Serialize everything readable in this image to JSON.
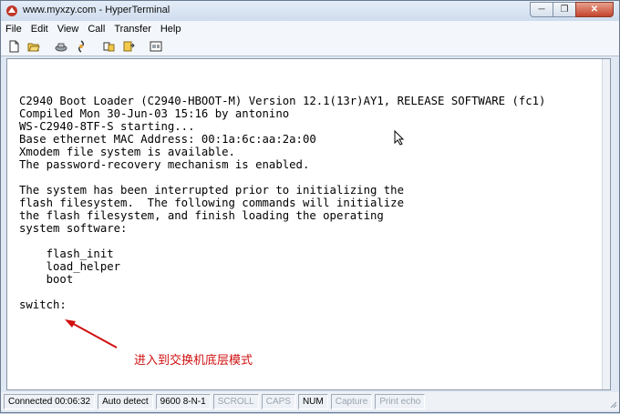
{
  "window": {
    "title": "www.myxzy.com - HyperTerminal",
    "minimize_glyph": "─",
    "restore_glyph": "❐",
    "close_glyph": "✕"
  },
  "menu": [
    "File",
    "Edit",
    "View",
    "Call",
    "Transfer",
    "Help"
  ],
  "toolbar": {
    "icons": [
      "new-connection-icon",
      "open-icon",
      "call-icon",
      "disconnect-icon",
      "send-icon",
      "receive-icon",
      "properties-icon"
    ]
  },
  "terminal": {
    "text": "C2940 Boot Loader (C2940-HBOOT-M) Version 12.1(13r)AY1, RELEASE SOFTWARE (fc1)\nCompiled Mon 30-Jun-03 15:16 by antonino\nWS-C2940-8TF-S starting...\nBase ethernet MAC Address: 00:1a:6c:aa:2a:00\nXmodem file system is available.\nThe password-recovery mechanism is enabled.\n\nThe system has been interrupted prior to initializing the\nflash filesystem.  The following commands will initialize\nthe flash filesystem, and finish loading the operating\nsystem software:\n\n    flash_init\n    load_helper\n    boot\n\nswitch:"
  },
  "annotation": {
    "text": "进入到交换机底层模式",
    "color": "#d01010"
  },
  "statusbar": {
    "connected": "Connected 00:06:32",
    "detect": "Auto detect",
    "settings": "9600 8-N-1",
    "scroll": "SCROLL",
    "caps": "CAPS",
    "num": "NUM",
    "capture": "Capture",
    "print_echo": "Print echo"
  }
}
